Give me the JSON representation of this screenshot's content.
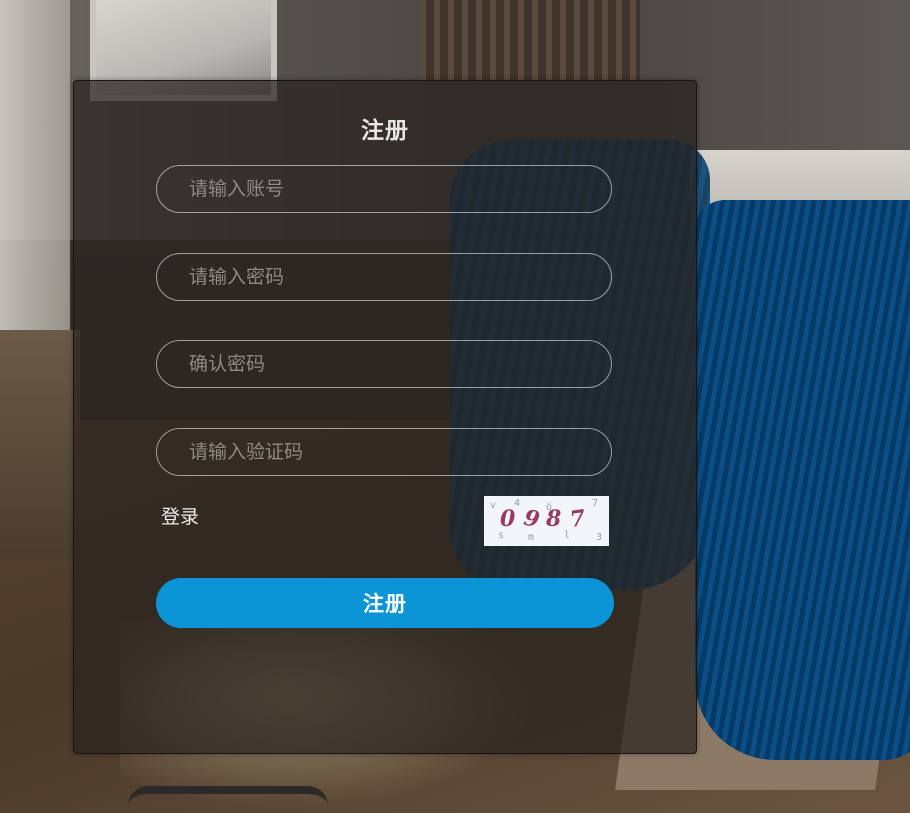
{
  "panel": {
    "title": "注册"
  },
  "form": {
    "account_placeholder": "请输入账号",
    "password_placeholder": "请输入密码",
    "confirm_placeholder": "确认密码",
    "captcha_placeholder": "请输入验证码"
  },
  "links": {
    "login_label": "登录"
  },
  "captcha": {
    "digits": [
      "0",
      "9",
      "8",
      "7"
    ],
    "color": "#9a3a62"
  },
  "submit": {
    "label": "注册",
    "color": "#0b95d6"
  }
}
